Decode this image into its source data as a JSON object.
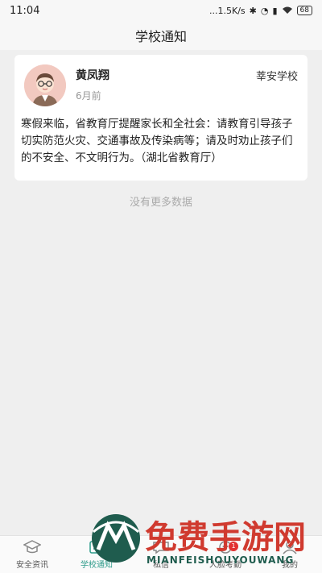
{
  "status_bar": {
    "time": "11:04",
    "net_speed": "...1.5K/s",
    "battery": "68"
  },
  "header": {
    "title": "学校通知"
  },
  "notice": {
    "author": "黄凤翔",
    "time_ago": "6月前",
    "school": "莘安学校",
    "content": "寒假来临，省教育厅提醒家长和全社会：请教育引导孩子切实防范火灾、交通事故及传染病等；请及时劝止孩子们的不安全、不文明行为。（湖北省教育厅）"
  },
  "list_footer": {
    "no_more": "没有更多数据"
  },
  "tabbar": {
    "items": [
      {
        "label": "安全资讯",
        "icon": "graduation-cap-icon"
      },
      {
        "label": "学校通知",
        "icon": "notice-icon"
      },
      {
        "label": "私信",
        "icon": "message-icon"
      },
      {
        "label": "人脸考勤",
        "icon": "face-icon",
        "badge": "1"
      },
      {
        "label": "我的",
        "icon": "user-icon"
      }
    ],
    "active_index": 1,
    "active_color": "#2d9b8a"
  },
  "watermark": {
    "title": "免费手游网",
    "subtitle": "MIANFEISHOUYOUWANG"
  }
}
